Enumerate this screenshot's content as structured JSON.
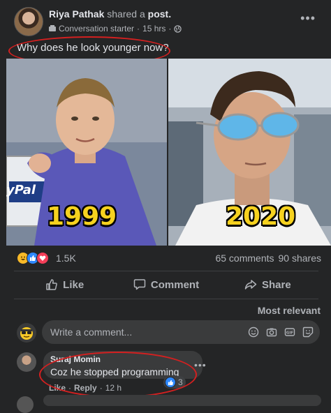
{
  "post": {
    "author": "Riya Pathak",
    "action": "shared a",
    "object": "post.",
    "badge": "Conversation starter",
    "time": "15 hrs",
    "text": "Why does he look younger now?"
  },
  "photos": {
    "left_year": "1999",
    "left_sign": "yPal",
    "right_year": "2020"
  },
  "reactions": {
    "count": "1.5K",
    "icons": [
      "haha-icon",
      "like-icon",
      "love-icon"
    ],
    "comments": "65 comments",
    "shares": "90 shares"
  },
  "actions": {
    "like": "Like",
    "comment": "Comment",
    "share": "Share"
  },
  "sort_label": "Most relevant",
  "comment_input": {
    "placeholder": "Write a comment..."
  },
  "comment": {
    "author": "Suraj Momin",
    "text": "Coz he stopped programming",
    "like_label": "Like",
    "reply_label": "Reply",
    "time": "12 h",
    "reaction_count": "3"
  },
  "colors": {
    "background": "#242526",
    "bubble": "#3a3b3c",
    "accent_blue": "#2d88ff",
    "highlight_red": "#d32020",
    "year_yellow": "#f6d21f"
  }
}
